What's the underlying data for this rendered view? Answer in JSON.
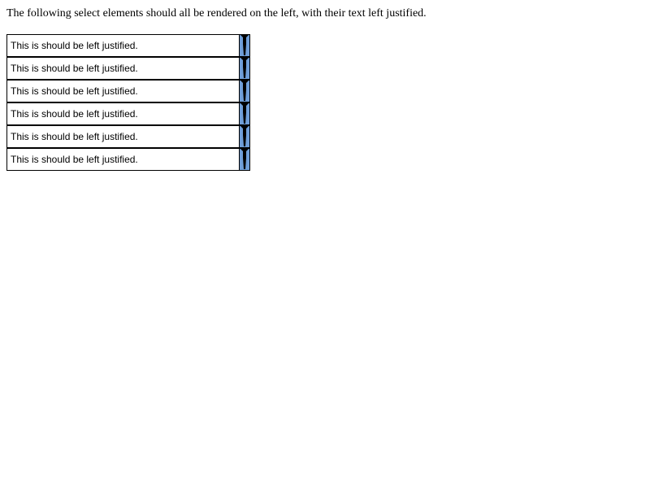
{
  "page": {
    "intro": "The following select elements should all be rendered on the left, with their text left justified."
  },
  "selects": [
    {
      "value": "This is should be left justified."
    },
    {
      "value": "This is should be left justified."
    },
    {
      "value": "This is should be left justified."
    },
    {
      "value": "This is should be left justified."
    },
    {
      "value": "This is should be left justified."
    },
    {
      "value": "This is should be left justified."
    }
  ],
  "colors": {
    "button": "#6f9ed8",
    "border": "#000000"
  },
  "icons": {
    "dropdown": "dropdown-arrow-icon"
  }
}
